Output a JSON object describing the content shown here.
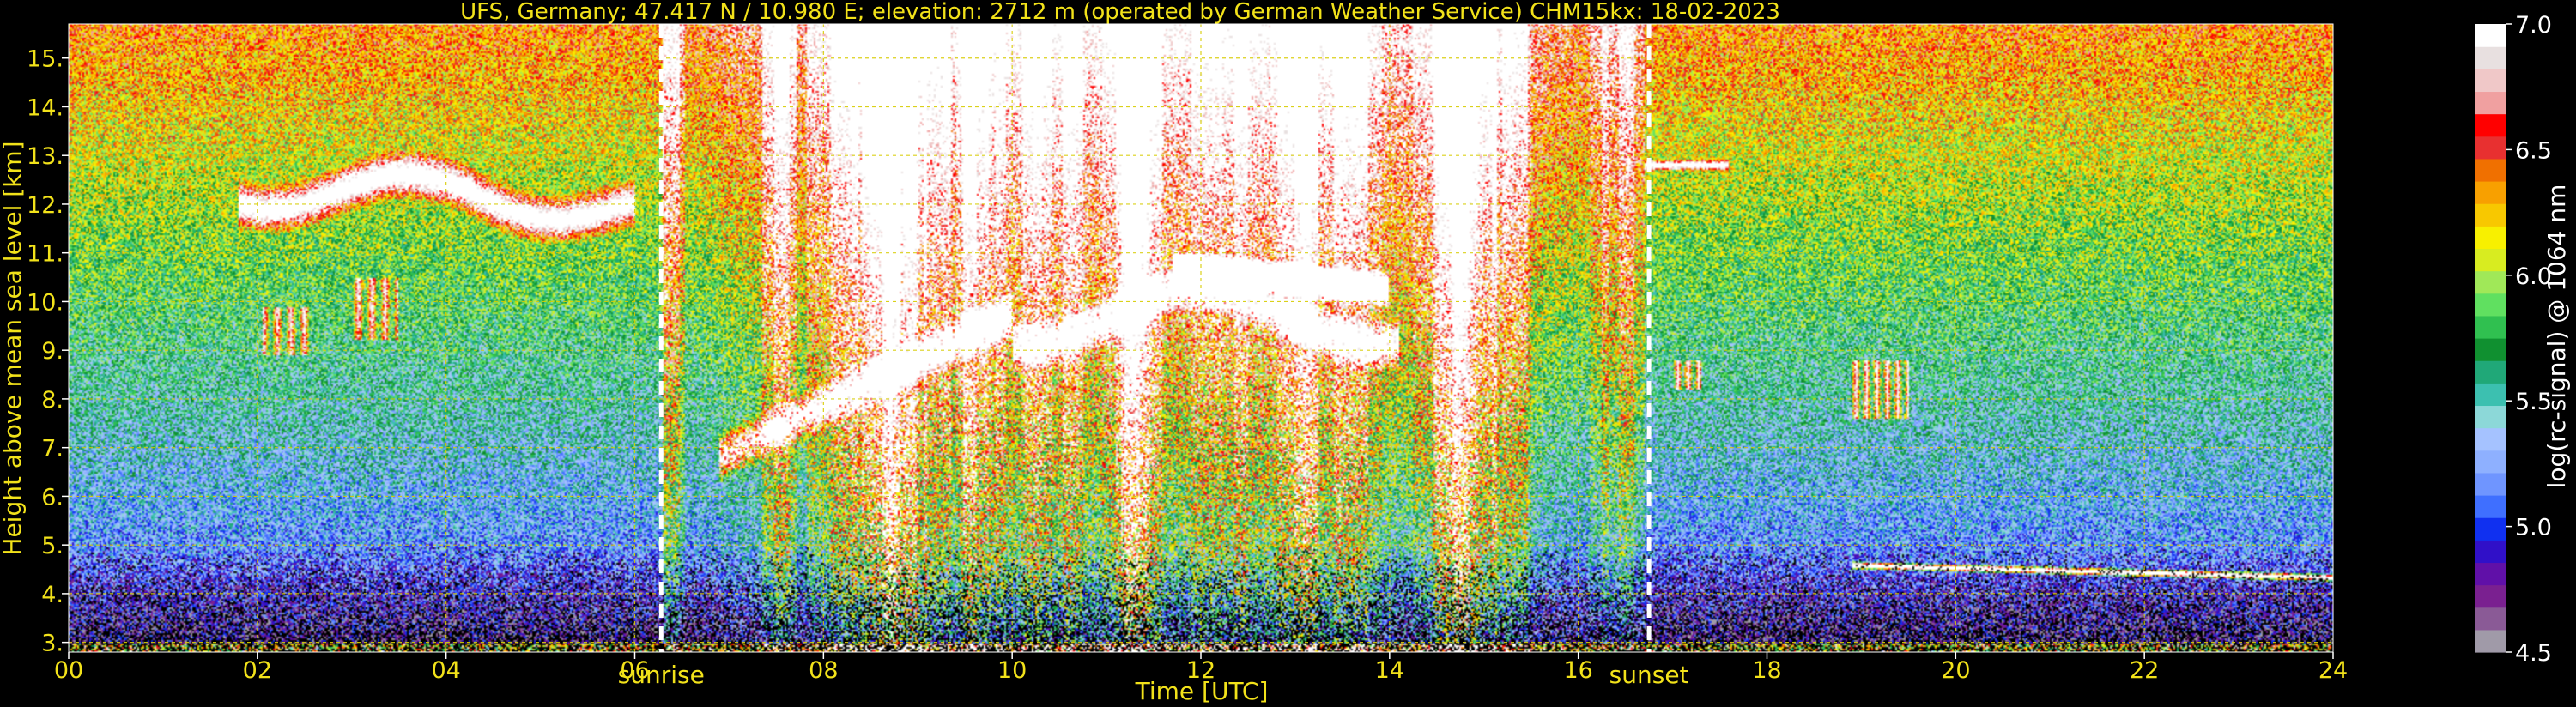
{
  "chart_data": {
    "type": "heatmap",
    "title": "UFS, Germany; 47.417 N / 10.980 E; elevation: 2712 m  (operated by German Weather Service)    CHM15kx: 18-02-2023",
    "xlabel": "Time [UTC]",
    "ylabel": "Height above mean sea level [km]",
    "xlim": [
      0,
      24
    ],
    "ylim": [
      2.8,
      15.7
    ],
    "x_ticks": [
      0,
      2,
      4,
      6,
      8,
      10,
      12,
      14,
      16,
      18,
      20,
      22,
      24
    ],
    "x_tick_labels": [
      "00",
      "02",
      "04",
      "06",
      "08",
      "10",
      "12",
      "14",
      "16",
      "18",
      "20",
      "22",
      "24"
    ],
    "y_ticks": [
      3,
      4,
      5,
      6,
      7,
      8,
      9,
      10,
      11,
      12,
      13,
      14,
      15
    ],
    "y_tick_labels": [
      "3.",
      "4.",
      "5.",
      "6.",
      "7.",
      "8.",
      "9.",
      "10.",
      "11.",
      "12.",
      "13.",
      "14.",
      "15."
    ],
    "grid": true,
    "grid_color": "#d8cc00",
    "annotations": [
      {
        "label": "sunrise",
        "x": 6.28
      },
      {
        "label": "sunset",
        "x": 16.75
      }
    ],
    "colorbar": {
      "label": "log(rc-signal) @ 1064 nm",
      "range": [
        4.5,
        7.0
      ],
      "tick_values": [
        4.5,
        5.0,
        5.5,
        6.0,
        6.5,
        7.0
      ],
      "tick_labels": [
        "4.5",
        "5.0",
        "5.5",
        "6.0",
        "6.5",
        "7.0"
      ],
      "colors": [
        "#a09aa8",
        "#8a5a96",
        "#7a2090",
        "#6010a8",
        "#3010c8",
        "#1030f0",
        "#3f6fff",
        "#6f95ff",
        "#8eb0ff",
        "#a5c2ff",
        "#8cd8d8",
        "#3cc0b0",
        "#20a878",
        "#109030",
        "#30c050",
        "#60e060",
        "#a0e858",
        "#d8ec20",
        "#f8f000",
        "#f8c800",
        "#f8a000",
        "#f07000",
        "#e83030",
        "#ff0000",
        "#f0a0a0",
        "#f0c8c8",
        "#e8e0e0",
        "#ffffff"
      ]
    },
    "features": [
      {
        "name": "upper cloud band",
        "x_range": [
          1.8,
          6.0
        ],
        "height_km": [
          11.3,
          13.0
        ],
        "level": "6.3-6.6"
      },
      {
        "name": "virga streaks",
        "x_range": [
          2.0,
          3.6
        ],
        "height_km": [
          9.0,
          10.5
        ],
        "level": "6.3-6.6"
      },
      {
        "name": "daytime aerosol",
        "x_range": [
          6.3,
          16.7
        ],
        "height_km": [
          3.2,
          15.7
        ],
        "level": "6.8-7.0"
      },
      {
        "name": "rising cloud base",
        "x_range": [
          6.9,
          14.1
        ],
        "height_km": [
          6.6,
          11.1
        ],
        "level": "7.0"
      },
      {
        "name": "evening cloud layer",
        "x_range": [
          16.7,
          17.6
        ],
        "height_km": [
          12.7,
          12.9
        ],
        "level": "6.4"
      },
      {
        "name": "evening cloud fragments",
        "x_range": [
          17.0,
          19.5
        ],
        "height_km": [
          7.8,
          8.8
        ],
        "level": "6.5"
      },
      {
        "name": "low layer",
        "x_range": [
          18.9,
          24.0
        ],
        "height_km": [
          4.2,
          4.6
        ],
        "level": "7.0"
      },
      {
        "name": "near-surface signal",
        "x_range": [
          0,
          24
        ],
        "height_km": [
          2.8,
          3.0
        ],
        "level": "5.0-7.0"
      }
    ]
  }
}
